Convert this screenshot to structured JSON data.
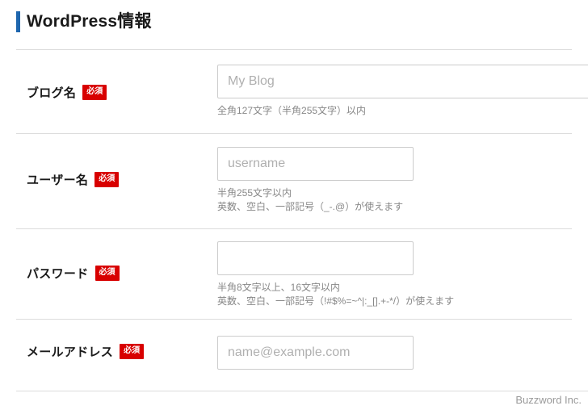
{
  "header": {
    "title": "WordPress情報",
    "accent_color": "#1e66ae"
  },
  "badges": {
    "required_label": "必須",
    "required_color": "#d80000"
  },
  "form": {
    "rows": [
      {
        "label": "ブログ名",
        "required": "必須",
        "input_placeholder": "My Blog",
        "input_value": "",
        "help_lines": [
          "全角127文字（半角255文字）以内"
        ]
      },
      {
        "label": "ユーザー名",
        "required": "必須",
        "input_placeholder": "username",
        "input_value": "",
        "help_lines": [
          "半角255文字以内",
          "英数、空白、一部記号（_-.@）が使えます"
        ]
      },
      {
        "label": "パスワード",
        "required": "必須",
        "input_placeholder": "",
        "input_value": "",
        "help_lines": [
          "半角8文字以上、16文字以内",
          "英数、空白、一部記号（!#$%=~^|:_[].+-*/）が使えます"
        ]
      },
      {
        "label": "メールアドレス",
        "required": "必須",
        "input_placeholder": "name@example.com",
        "input_value": "",
        "help_lines": []
      }
    ]
  },
  "footer": {
    "watermark": "Buzzword Inc."
  }
}
